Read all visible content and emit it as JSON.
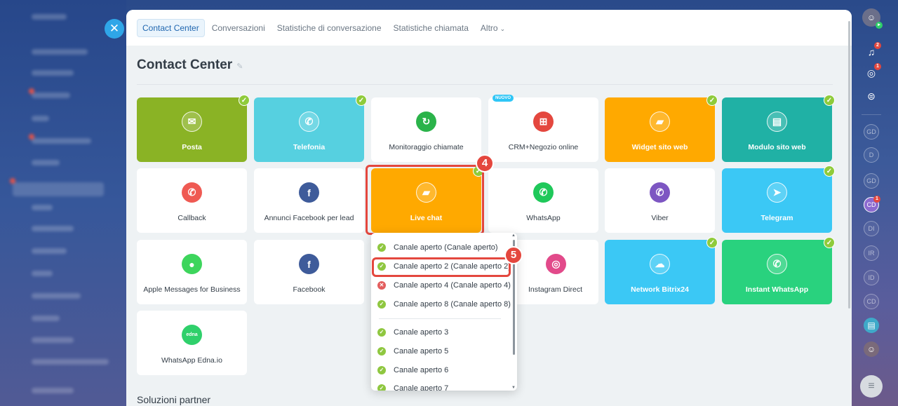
{
  "colors": {
    "accent": "#2067b0",
    "posta": "#8ab325",
    "telefonia": "#56d0e0",
    "orange": "#ffa900",
    "teal": "#20b1a5",
    "sky": "#3bc8f5",
    "green": "#29d27e",
    "highlight": "#e4473e"
  },
  "close_icon": "close-icon",
  "tabs": [
    {
      "label": "Contact Center",
      "active": true
    },
    {
      "label": "Conversazioni"
    },
    {
      "label": "Statistiche di conversazione"
    },
    {
      "label": "Statistiche chiamata"
    },
    {
      "label": "Altro",
      "chevron": "chevron-down-icon"
    }
  ],
  "page_title": "Contact Center",
  "tiles": [
    {
      "label": "Posta",
      "icon": "mail-icon"
    },
    {
      "label": "Telefonia",
      "icon": "phone-icon"
    },
    {
      "label": "Monitoraggio chiamate",
      "icon": "call-tracking-icon"
    },
    {
      "label": "CRM+Negozio online",
      "icon": "store-icon",
      "badge": "NUOVO"
    },
    {
      "label": "Widget sito web",
      "icon": "chat-widget-icon"
    },
    {
      "label": "Modulo sito web",
      "icon": "form-icon"
    },
    {
      "label": "Callback",
      "icon": "callback-icon"
    },
    {
      "label": "Annunci Facebook per lead",
      "icon": "facebook-lead-icon"
    },
    {
      "label": "Live chat",
      "icon": "live-chat-icon"
    },
    {
      "label": "WhatsApp",
      "icon": "whatsapp-icon"
    },
    {
      "label": "Viber",
      "icon": "viber-icon"
    },
    {
      "label": "Telegram",
      "icon": "telegram-icon"
    },
    {
      "label": "Apple Messages for Business",
      "icon": "apple-messages-icon"
    },
    {
      "label": "Facebook",
      "icon": "facebook-icon"
    },
    {
      "label": "Instagram Direct",
      "icon": "instagram-icon"
    },
    {
      "label": "Network Bitrix24",
      "icon": "cloud-icon"
    },
    {
      "label": "Instant WhatsApp",
      "icon": "whatsapp-icon"
    },
    {
      "label": "WhatsApp Edna.io",
      "icon": "edna-icon",
      "icon_text": "edna"
    }
  ],
  "steps": [
    "4",
    "5"
  ],
  "dropdown": {
    "items": [
      {
        "label": "Canale aperto (Canale aperto)",
        "status": "ok"
      },
      {
        "label": "Canale aperto 2 (Canale aperto 2)",
        "status": "ok"
      },
      {
        "label": "Canale aperto 4 (Canale aperto 4)",
        "status": "error"
      },
      {
        "label": "Canale aperto 8 (Canale aperto 8)",
        "status": "ok"
      },
      {
        "label": "Canale aperto 3",
        "status": "ok"
      },
      {
        "label": "Canale aperto 5",
        "status": "ok"
      },
      {
        "label": "Canale aperto 6",
        "status": "ok"
      },
      {
        "label": "Canale aperto 7",
        "status": "ok"
      }
    ]
  },
  "partner_title": "Soluzioni partner",
  "right_bar": {
    "notification_count": "2",
    "activity_count": "1",
    "chat_count": "1",
    "avatars": [
      "GD",
      "D",
      "GD",
      "CD",
      "DI",
      "IR",
      "ID",
      "CD"
    ]
  }
}
